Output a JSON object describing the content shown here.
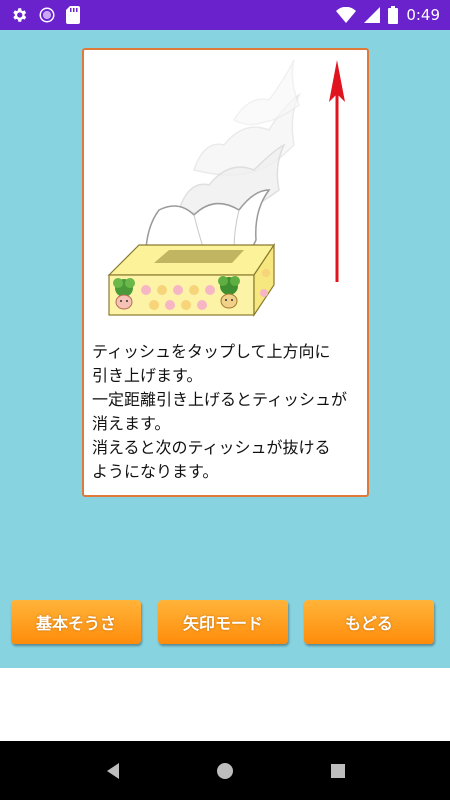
{
  "status_bar": {
    "time": "0:49",
    "icons": [
      "settings-icon",
      "circle-notification-icon",
      "sd-card-icon",
      "wifi-icon",
      "cellular-signal-icon",
      "battery-icon"
    ],
    "background_color": "#6a22cc"
  },
  "app": {
    "background_color": "#87d3e0",
    "card": {
      "border_color": "#e07a3a",
      "instructions": [
        "ティッシュをタップして上方向に",
        "引き上げます。",
        "一定距離引き上げるとティッシュが",
        "消えます。",
        "消えると次のティッシュが抜ける",
        "ようになります。"
      ],
      "arrow_color": "#e0141e"
    },
    "buttons": {
      "basic": "基本そうさ",
      "arrow_mode": "矢印モード",
      "back": "もどる",
      "color": "#ff9a1a"
    }
  },
  "navigation_bar": {
    "icons": [
      "back-triangle-icon",
      "home-circle-icon",
      "recents-square-icon"
    ]
  }
}
